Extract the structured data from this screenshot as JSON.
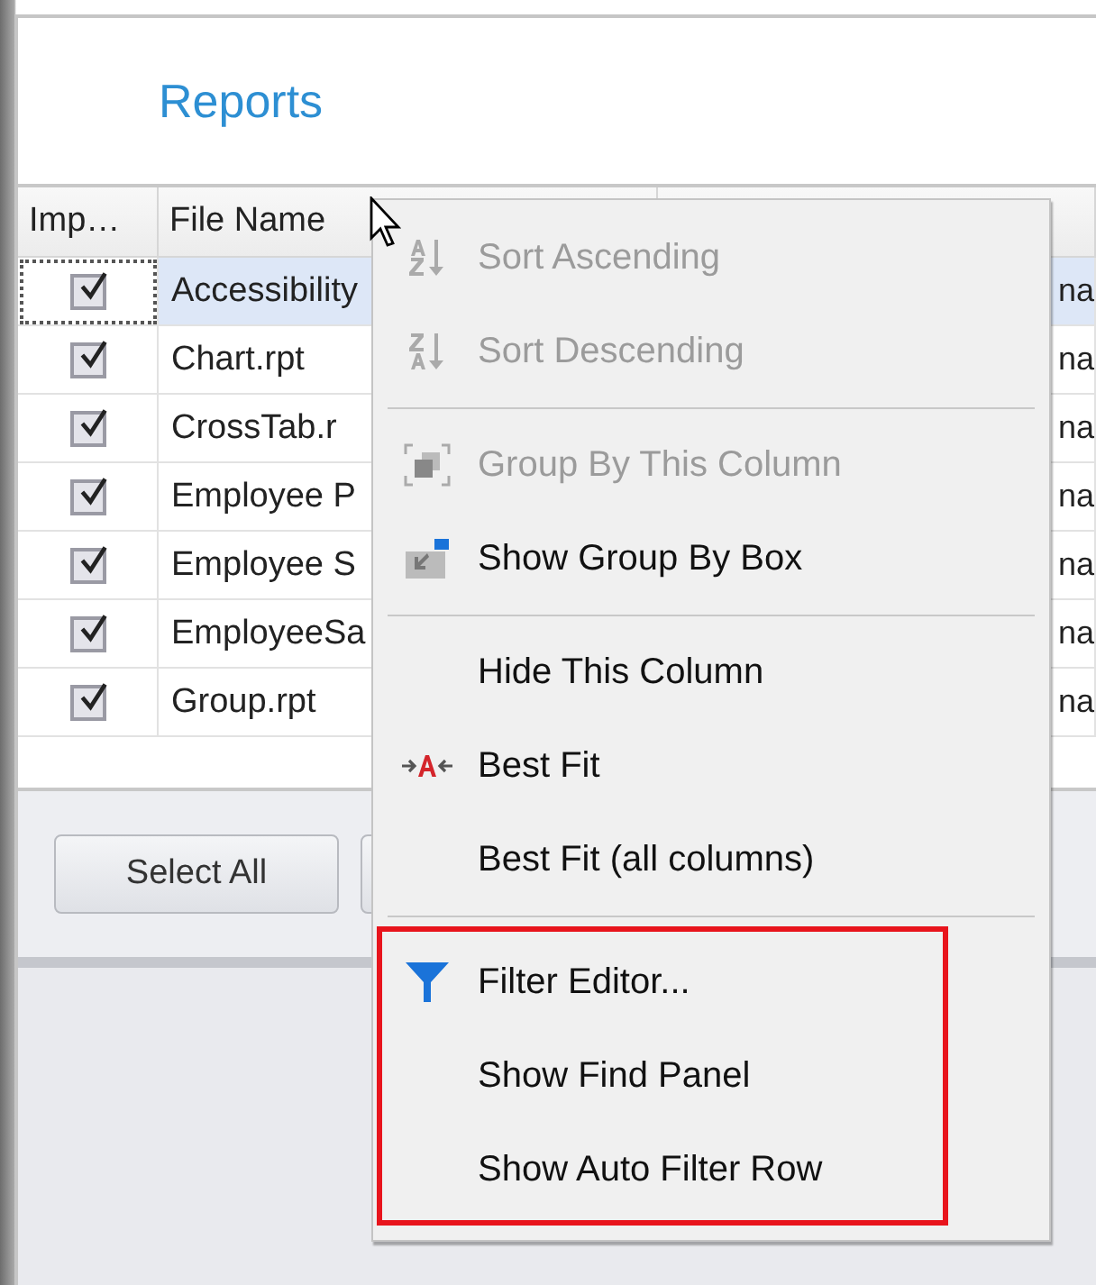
{
  "window": {
    "title": "Reports"
  },
  "grid": {
    "columns": [
      {
        "label": "Imp…"
      },
      {
        "label": "File Name"
      }
    ],
    "rows": [
      {
        "checked": true,
        "selected": true,
        "file_name": "Accessibility",
        "column_3": "na"
      },
      {
        "checked": true,
        "selected": false,
        "file_name": "Chart.rpt",
        "column_3": "na"
      },
      {
        "checked": true,
        "selected": false,
        "file_name": "CrossTab.r",
        "column_3": "na"
      },
      {
        "checked": true,
        "selected": false,
        "file_name": "Employee P",
        "column_3": "na"
      },
      {
        "checked": true,
        "selected": false,
        "file_name": "Employee S",
        "column_3": "na"
      },
      {
        "checked": true,
        "selected": false,
        "file_name": "EmployeeSa",
        "column_3": "na"
      },
      {
        "checked": true,
        "selected": false,
        "file_name": "Group.rpt",
        "column_3": "na"
      }
    ]
  },
  "buttons": [
    "Select All"
  ],
  "context_menu": {
    "sections": [
      {
        "highlighted": false,
        "items": [
          {
            "kind": "sort-ascending",
            "label": "Sort Ascending",
            "disabled": true
          },
          {
            "kind": "sort-descending",
            "label": "Sort Descending",
            "disabled": true
          }
        ]
      },
      {
        "highlighted": false,
        "items": [
          {
            "kind": "group",
            "label": "Group By This Column",
            "disabled": true
          },
          {
            "kind": "group-box",
            "label": "Show Group By Box",
            "disabled": false
          }
        ]
      },
      {
        "highlighted": false,
        "items": [
          {
            "kind": "plain",
            "label": "Hide This Column",
            "disabled": false
          },
          {
            "kind": "best-fit",
            "label": "Best Fit",
            "disabled": false
          },
          {
            "kind": "plain",
            "label": "Best Fit (all columns)",
            "disabled": false
          }
        ]
      },
      {
        "highlighted": true,
        "items": [
          {
            "kind": "filter",
            "label": "Filter Editor...",
            "disabled": false
          },
          {
            "kind": "plain",
            "label": "Show Find Panel",
            "disabled": false
          },
          {
            "kind": "plain",
            "label": "Show Auto Filter Row",
            "disabled": false
          }
        ]
      }
    ]
  }
}
